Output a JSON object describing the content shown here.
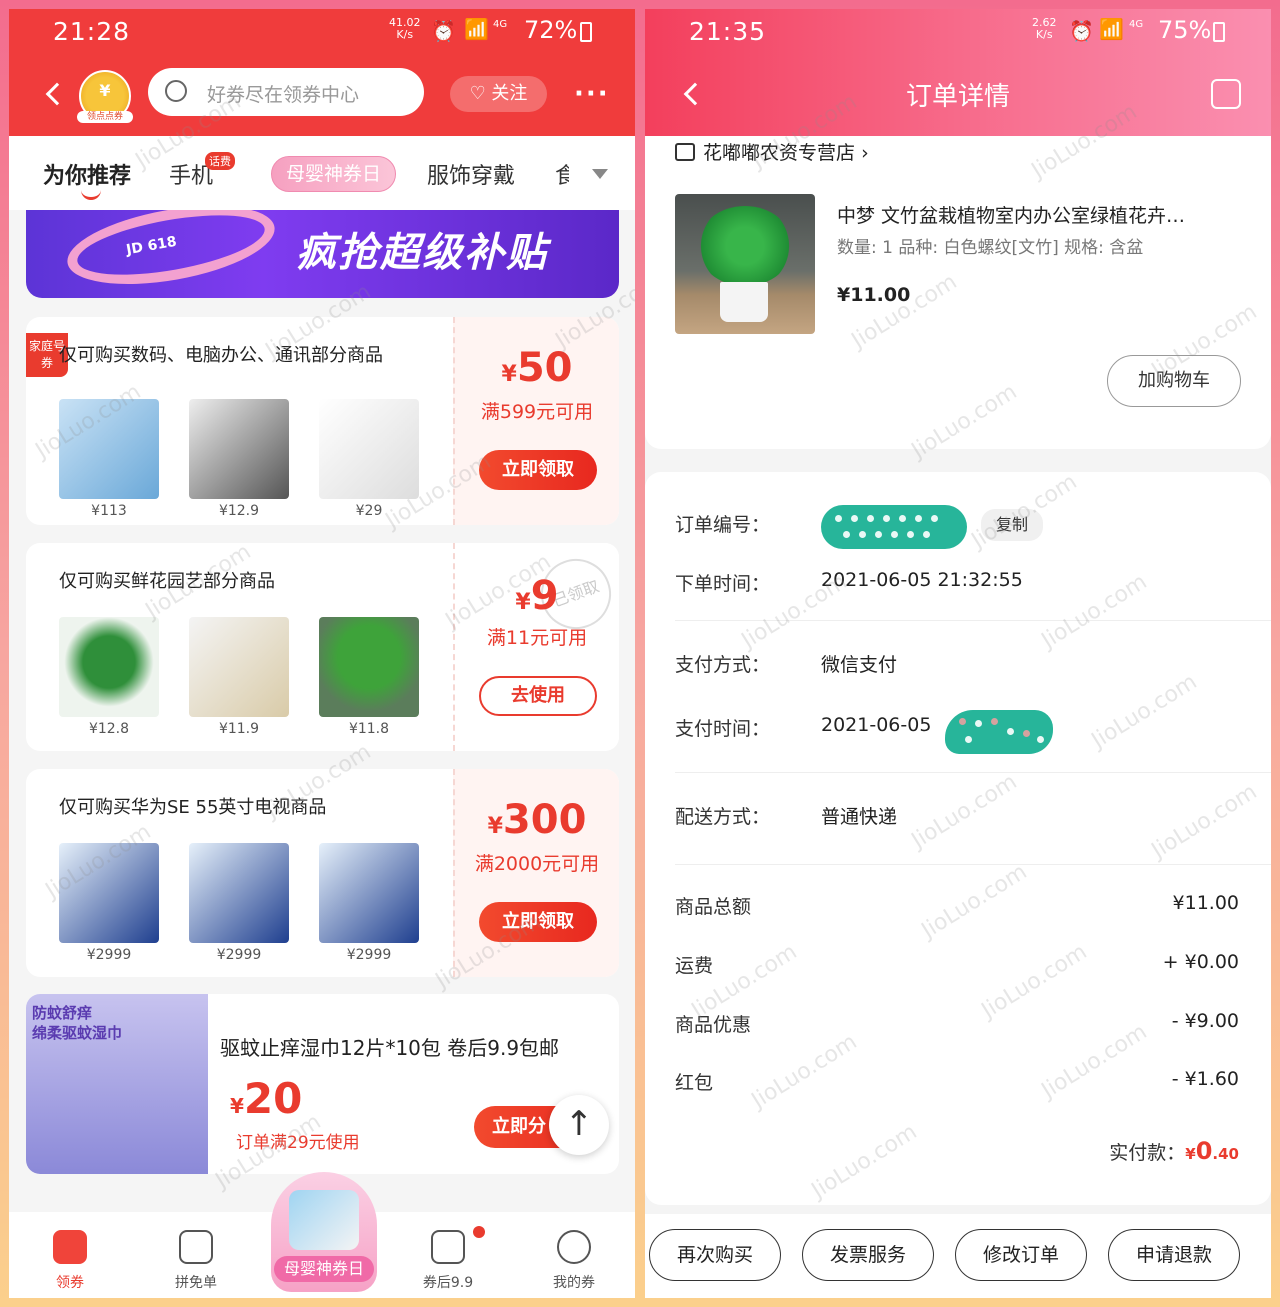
{
  "left": {
    "status": {
      "time": "21:28",
      "speed": "41.02",
      "speed_unit": "K/s",
      "signal": "4G",
      "battery": "72%"
    },
    "header": {
      "coin_label": "领点点券",
      "coin_symbol": "¥",
      "search_placeholder": "好券尽在领券中心",
      "follow_label": "关注",
      "more": "···"
    },
    "tabs": [
      {
        "label": "为你推荐",
        "active": true
      },
      {
        "label": "手机",
        "badge": "话费"
      },
      {
        "label": "母婴神券日"
      },
      {
        "label": "服饰穿戴"
      },
      {
        "label": "食"
      }
    ],
    "banner": {
      "text": "疯抢超级补贴",
      "sub": "JD 618"
    },
    "coupons": [
      {
        "badge": "家庭号券",
        "title": "仅可购买数码、电脑办公、通讯部分商品",
        "currency": "¥",
        "amount": "50",
        "condition": "满599元可用",
        "button": "立即领取",
        "button_style": "filled",
        "products": [
          {
            "price": "¥113"
          },
          {
            "price": "¥12.9"
          },
          {
            "price": "¥29"
          }
        ]
      },
      {
        "title": "仅可购买鲜花园艺部分商品",
        "currency": "¥",
        "amount": "9",
        "condition": "满11元可用",
        "button": "去使用",
        "button_style": "outline",
        "stamp": "已领取",
        "products": [
          {
            "price": "¥12.8"
          },
          {
            "price": "¥11.9"
          },
          {
            "price": "¥11.8"
          }
        ]
      },
      {
        "title": "仅可购买华为SE 55英寸电视商品",
        "currency": "¥",
        "amount": "300",
        "condition": "满2000元可用",
        "button": "立即领取",
        "button_style": "filled",
        "products": [
          {
            "price": "¥2999"
          },
          {
            "price": "¥2999"
          },
          {
            "price": "¥2999"
          }
        ]
      }
    ],
    "promo": {
      "img_text_1": "防蚊舒痒",
      "img_text_2": "绵柔驱蚊湿巾",
      "title": "驱蚊止痒湿巾12片*10包 卷后9.9包邮",
      "currency": "¥",
      "amount": "20",
      "condition": "订单满29元使用",
      "button": "立即分"
    },
    "scroll_top": "↑",
    "bottom_nav": [
      {
        "label": "领券",
        "active": true
      },
      {
        "label": "拼免单"
      },
      {
        "label": "母婴神券日"
      },
      {
        "label": "券后9.9"
      },
      {
        "label": "我的券"
      }
    ]
  },
  "right": {
    "status": {
      "time": "21:35",
      "speed": "2.62",
      "speed_unit": "K/s",
      "signal": "4G",
      "battery": "75%"
    },
    "header": {
      "title": "订单详情"
    },
    "store": {
      "name": "花嘟嘟农资专营店",
      "chevron": "›"
    },
    "product": {
      "name": "中梦 文竹盆栽植物室内办公室绿植花卉…",
      "attrs": "数量: 1   品种: 白色螺纹[文竹]   规格: 含盆",
      "price": "¥11.00",
      "cart_button": "加购物车"
    },
    "order": {
      "number_label": "订单编号：",
      "copy": "复制",
      "time_label": "下单时间：",
      "time_value": "2021-06-05 21:32:55",
      "pay_method_label": "支付方式：",
      "pay_method_value": "微信支付",
      "pay_time_label": "支付时间：",
      "pay_time_value": "2021-06-05",
      "ship_label": "配送方式：",
      "ship_value": "普通快递"
    },
    "amounts": [
      {
        "label": "商品总额",
        "value": "¥11.00"
      },
      {
        "label": "运费",
        "value": "+ ¥0.00"
      },
      {
        "label": "商品优惠",
        "value": "- ¥9.00"
      },
      {
        "label": "红包",
        "value": "- ¥1.60"
      }
    ],
    "paid": {
      "label": "实付款：",
      "currency": "¥",
      "int": "0",
      "dec": ".40"
    },
    "actions": [
      "再次购买",
      "发票服务",
      "修改订单",
      "申请退款"
    ]
  },
  "watermark": "JioLuo.com",
  "colors": {
    "accent": "#e93b2e",
    "header_red": "#f03c3c",
    "redact": "#27b59a"
  }
}
